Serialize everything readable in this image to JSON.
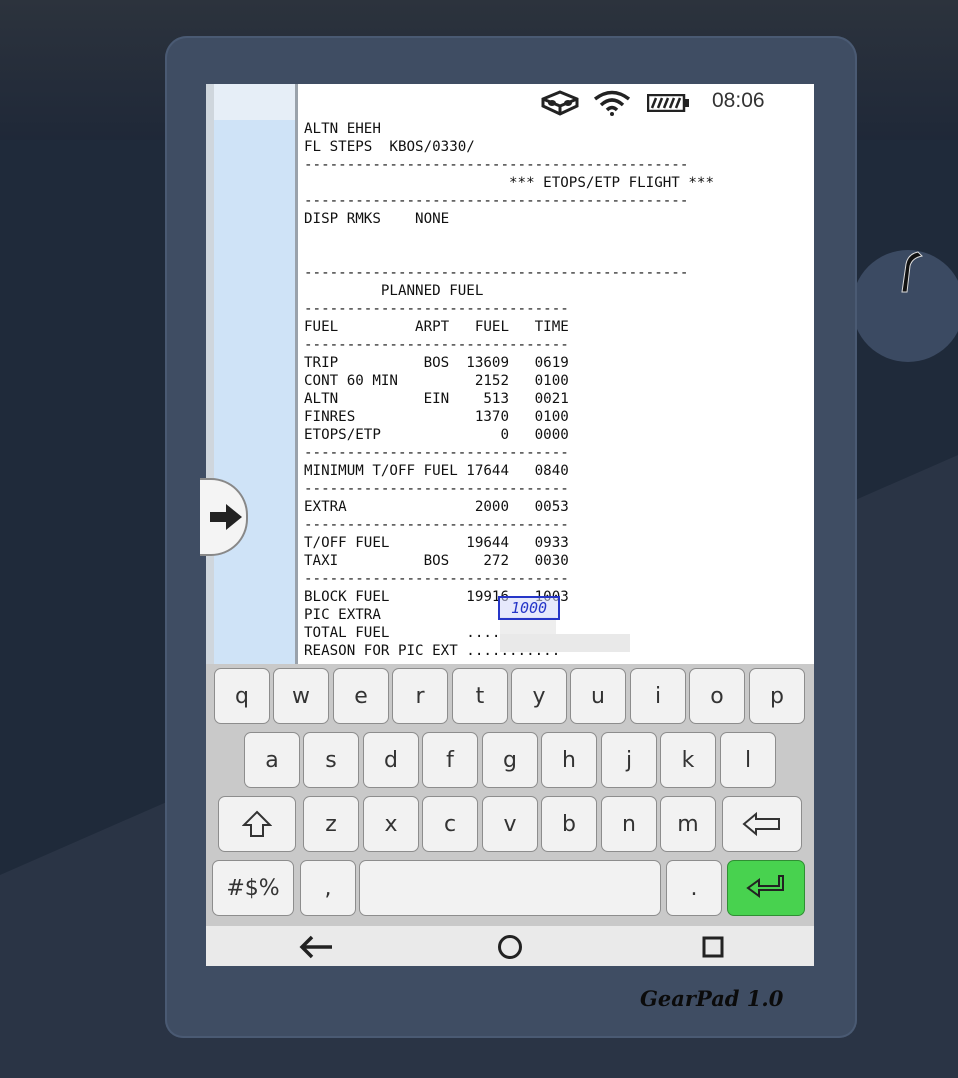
{
  "status": {
    "clock": "08:06",
    "icons": [
      "vr-headset-icon",
      "wifi-icon",
      "battery-icon"
    ]
  },
  "document": {
    "lines": [
      "ALTN EHEH",
      "FL STEPS  KBOS/0330/",
      "---------------------------------------------",
      "                        *** ETOPS/ETP FLIGHT ***",
      "---------------------------------------------",
      "DISP RMKS    NONE",
      "",
      "",
      "---------------------------------------------",
      "         PLANNED FUEL",
      "-------------------------------",
      "FUEL         ARPT   FUEL   TIME",
      "-------------------------------",
      "TRIP          BOS  13609   0619",
      "CONT 60 MIN         2152   0100",
      "ALTN          EIN    513   0021",
      "FINRES              1370   0100",
      "ETOPS/ETP              0   0000",
      "-------------------------------",
      "MINIMUM T/OFF FUEL 17644   0840",
      "-------------------------------",
      "EXTRA               2000   0053",
      "-------------------------------",
      "T/OFF FUEL         19644   0933",
      "TAXI          BOS    272   0030",
      "-------------------------------",
      "BLOCK FUEL         19916   1003",
      "PIC EXTRA",
      "TOTAL FUEL         .....",
      "REASON FOR PIC EXT ..........."
    ],
    "pic_extra_input": "1000"
  },
  "keyboard": {
    "row1": [
      "q",
      "w",
      "e",
      "r",
      "t",
      "y",
      "u",
      "i",
      "o",
      "p"
    ],
    "row2": [
      "a",
      "s",
      "d",
      "f",
      "g",
      "h",
      "j",
      "k",
      "l"
    ],
    "row3": [
      "z",
      "x",
      "c",
      "v",
      "b",
      "n",
      "m"
    ],
    "symbols_label": "#$%",
    "comma_label": ",",
    "period_label": ".",
    "shift_icon": "shift-icon",
    "backspace_icon": "backspace-icon",
    "enter_icon": "enter-icon",
    "enter_color": "#48d24f"
  },
  "navbar": {
    "icons": [
      "back-icon",
      "home-icon",
      "recents-icon"
    ]
  },
  "device": {
    "brand": "GearPad 1.0"
  }
}
